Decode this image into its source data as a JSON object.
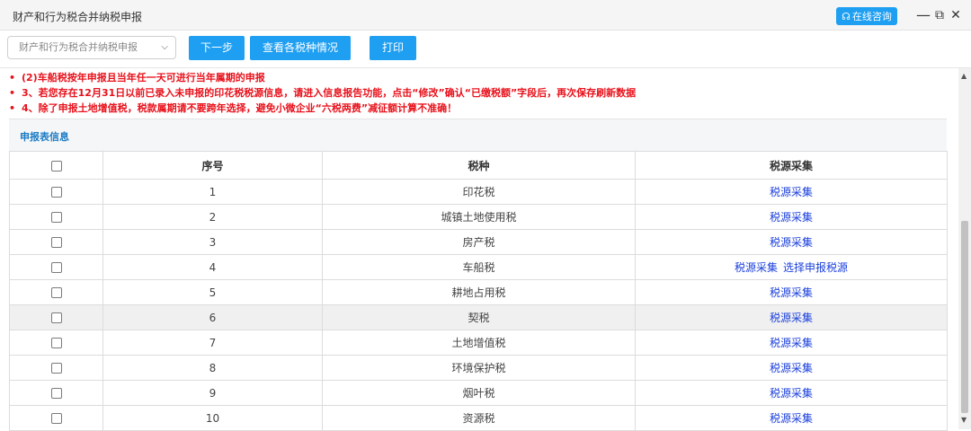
{
  "window": {
    "title": "财产和行为税合并纳税申报",
    "consult_label": "在线咨询",
    "minimize_glyph": "—",
    "restore_glyph": "⧉",
    "close_glyph": "✕"
  },
  "toolbar": {
    "tax_select": "财产和行为税合并纳税申报",
    "next_label": "下一步",
    "view_label": "查看各税种情况",
    "print_label": "打印"
  },
  "notices": [
    "(2)车船税按年申报且当年任一天可进行当年属期的申报",
    "3、若您存在12月31日以前已录入未申报的印花税税源信息，请进入信息报告功能，点击“修改”确认“已缴税额”字段后，再次保存刷新数据",
    "4、除了申报土地增值税，税款属期请不要跨年选择，避免小微企业“六税两费”减征额计算不准确！"
  ],
  "section_title": "申报表信息",
  "table": {
    "headers": [
      "序号",
      "税种",
      "税源采集"
    ],
    "rows": [
      {
        "no": "1",
        "tax": "印花税",
        "links": [
          "税源采集"
        ]
      },
      {
        "no": "2",
        "tax": "城镇土地使用税",
        "links": [
          "税源采集"
        ]
      },
      {
        "no": "3",
        "tax": "房产税",
        "links": [
          "税源采集"
        ]
      },
      {
        "no": "4",
        "tax": "车船税",
        "links": [
          "税源采集",
          "选择申报税源"
        ]
      },
      {
        "no": "5",
        "tax": "耕地占用税",
        "links": [
          "税源采集"
        ]
      },
      {
        "no": "6",
        "tax": "契税",
        "links": [
          "税源采集"
        ]
      },
      {
        "no": "7",
        "tax": "土地增值税",
        "links": [
          "税源采集"
        ]
      },
      {
        "no": "8",
        "tax": "环境保护税",
        "links": [
          "税源采集"
        ]
      },
      {
        "no": "9",
        "tax": "烟叶税",
        "links": [
          "税源采集"
        ]
      },
      {
        "no": "10",
        "tax": "资源税",
        "links": [
          "税源采集"
        ]
      }
    ]
  },
  "colors": {
    "accent": "#1e9ff2",
    "notice": "#e8111b",
    "link": "#1a3fdc",
    "section_title": "#1a7bc4"
  }
}
